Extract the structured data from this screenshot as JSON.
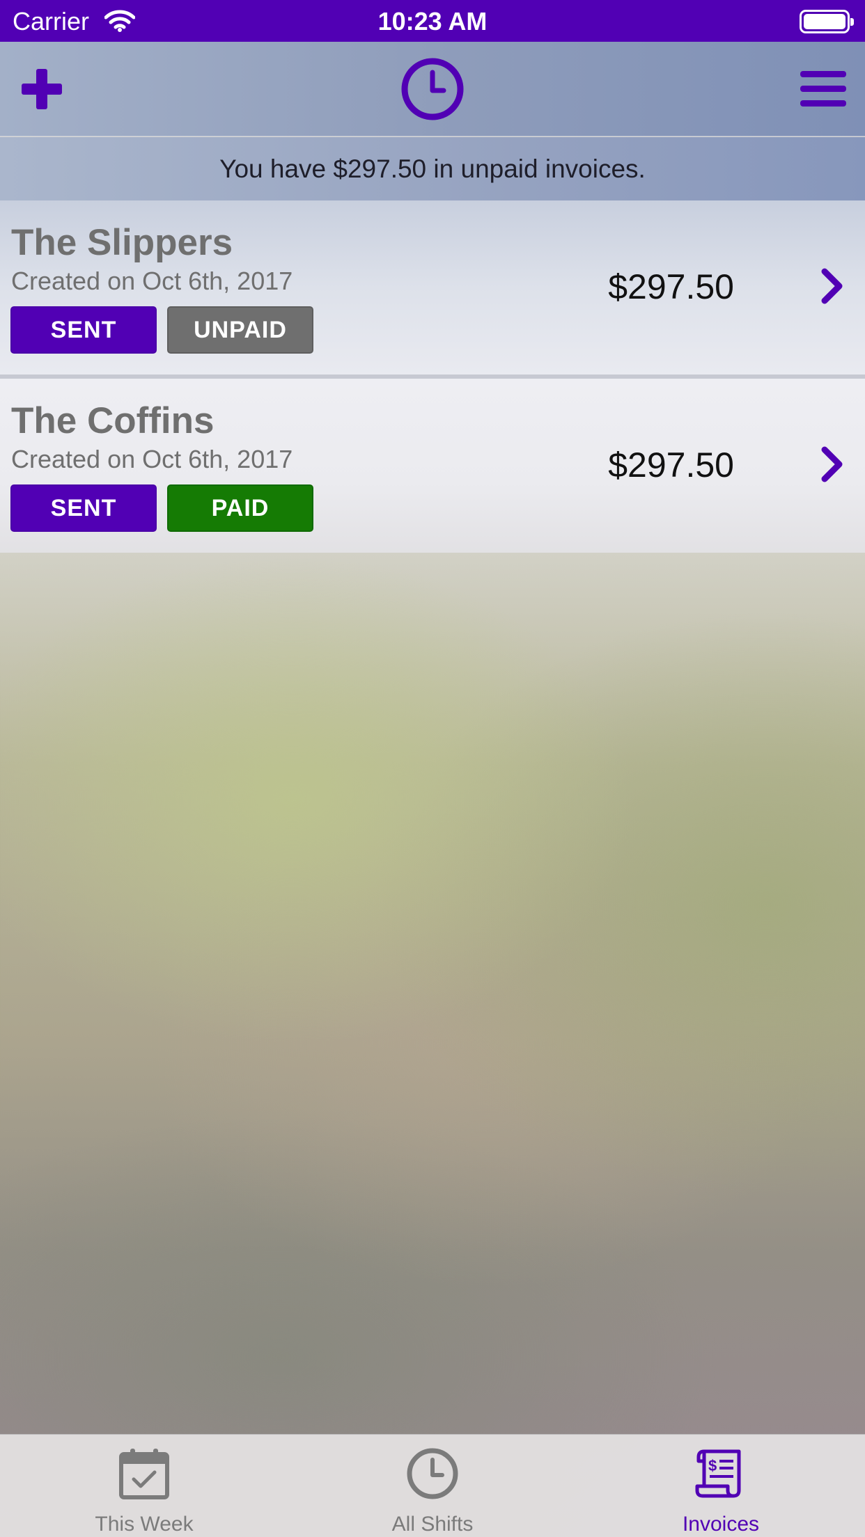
{
  "status_bar": {
    "carrier": "Carrier",
    "time": "10:23 AM",
    "wifi_icon": "wifi-icon",
    "battery_icon": "battery-icon"
  },
  "nav": {
    "left_icon": "plus-icon",
    "center_icon": "clock-icon",
    "right_icon": "hamburger-menu-icon"
  },
  "banner": {
    "text": "You have $297.50 in unpaid invoices."
  },
  "invoices": [
    {
      "client": "The Slippers",
      "created": "Created on Oct 6th, 2017",
      "sent_label": "SENT",
      "status_label": "UNPAID",
      "amount": "$297.50"
    },
    {
      "client": "The Coffins",
      "created": "Created on Oct 6th, 2017",
      "sent_label": "SENT",
      "status_label": "PAID",
      "amount": "$297.50"
    }
  ],
  "tabs": [
    {
      "label": "This Week",
      "icon": "calendar-check-icon",
      "active": false
    },
    {
      "label": "All Shifts",
      "icon": "clock-icon",
      "active": false
    },
    {
      "label": "Invoices",
      "icon": "invoice-scroll-icon",
      "active": true
    }
  ],
  "colors": {
    "brand_purple": "#5100b4",
    "paid_green": "#157b04",
    "unpaid_gray": "#6f6f6f"
  }
}
